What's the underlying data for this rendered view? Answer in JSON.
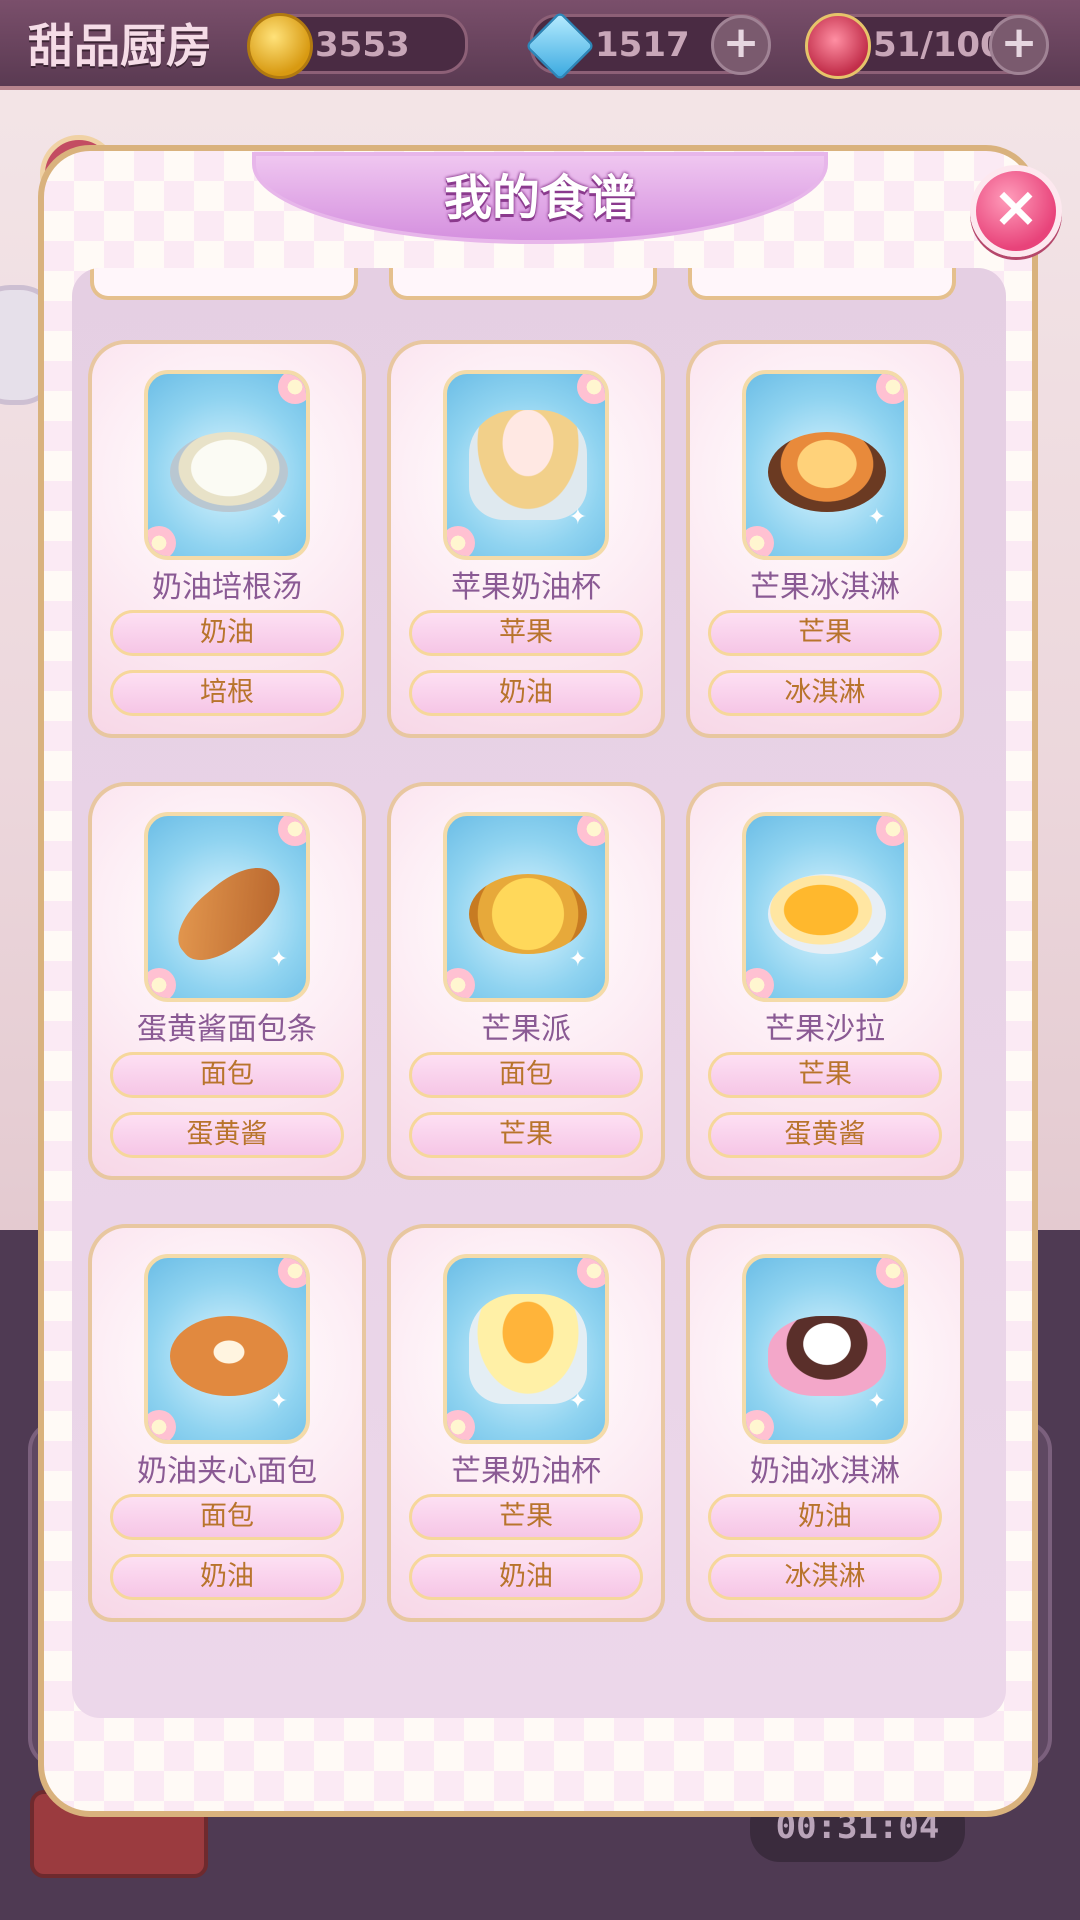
{
  "header": {
    "title": "甜品厨房",
    "coins": "3553",
    "gems": "1517",
    "roses": "51/100",
    "plus_label": "+",
    "icons": {
      "coin": "coin-icon",
      "gem": "diamond-icon",
      "rose": "rose-icon"
    }
  },
  "background": {
    "help_label": "?",
    "timer": "00:31:04"
  },
  "dialog": {
    "title": "我的食谱",
    "close_label": "×"
  },
  "recipes": [
    {
      "name": "奶油培根汤",
      "ingredients": [
        "奶油",
        "培根"
      ],
      "image": "cream-bacon-soup"
    },
    {
      "name": "苹果奶油杯",
      "ingredients": [
        "苹果",
        "奶油"
      ],
      "image": "apple-cream-cup"
    },
    {
      "name": "芒果冰淇淋",
      "ingredients": [
        "芒果",
        "冰淇淋"
      ],
      "image": "mango-ice-cream"
    },
    {
      "name": "蛋黄酱面包条",
      "ingredients": [
        "面包",
        "蛋黄酱"
      ],
      "image": "mayo-breadstick"
    },
    {
      "name": "芒果派",
      "ingredients": [
        "面包",
        "芒果"
      ],
      "image": "mango-pie"
    },
    {
      "name": "芒果沙拉",
      "ingredients": [
        "芒果",
        "蛋黄酱"
      ],
      "image": "mango-salad"
    },
    {
      "name": "奶油夹心面包",
      "ingredients": [
        "面包",
        "奶油"
      ],
      "image": "cream-filled-bread"
    },
    {
      "name": "芒果奶油杯",
      "ingredients": [
        "芒果",
        "奶油"
      ],
      "image": "mango-cream-cup"
    },
    {
      "name": "奶油冰淇淋",
      "ingredients": [
        "奶油",
        "冰淇淋"
      ],
      "image": "cream-ice-cream"
    }
  ],
  "colors": {
    "title_purple": "#8a5a94",
    "ingredient_text": "#b8742c",
    "ribbon": "#d590df",
    "close_pink": "#e8437a"
  }
}
